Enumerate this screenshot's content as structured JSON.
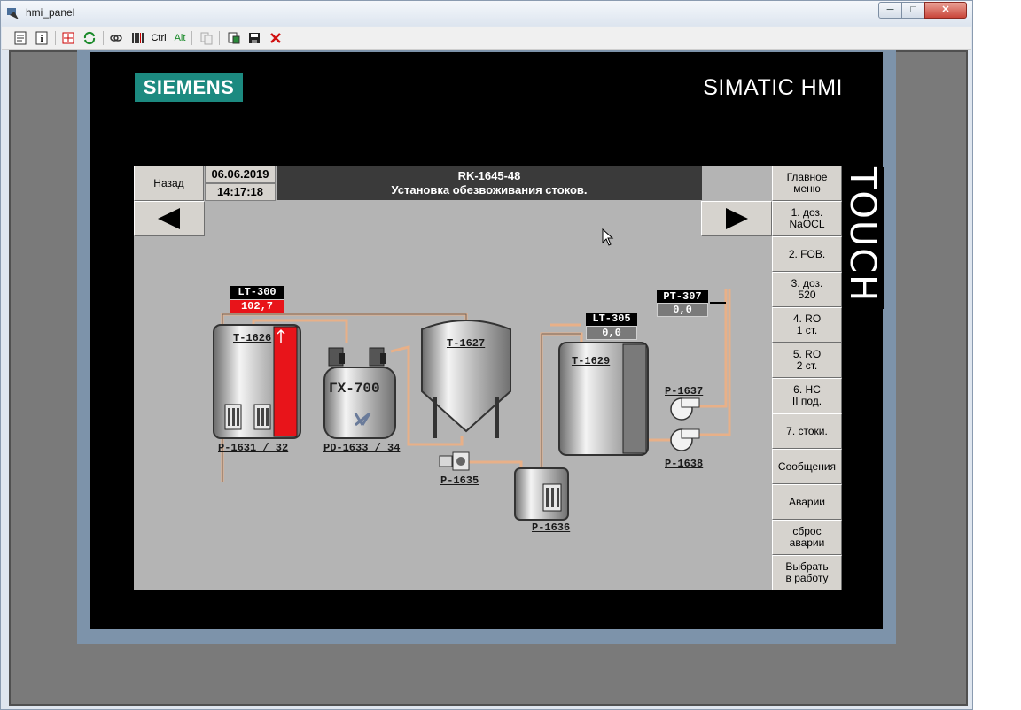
{
  "window": {
    "title": "hmi_panel",
    "buttons": {
      "minimize": "─",
      "maximize": "□",
      "close": "✕"
    }
  },
  "toolbar": {
    "items": [
      "properties-icon",
      "info-icon",
      "fullscreen-icon",
      "refresh-icon",
      "link-icon",
      "barcode-icon",
      "Ctrl",
      "Alt",
      "copy-icon",
      "paste-icon",
      "save-icon",
      "cancel-icon"
    ],
    "ctrl_label": "Ctrl",
    "alt_label": "Alt"
  },
  "panel": {
    "brand": "SIEMENS",
    "model": "SIMATIC HMI",
    "touch_label": "TOUCH",
    "brand_color": "#1c8a80"
  },
  "screen": {
    "back_label": "Назад",
    "date": "06.06.2019",
    "time": "14:17:18",
    "header_line1": "RK-1645-48",
    "header_line2": "Установка обезвоживания стоков.",
    "prev_arrow": "◀",
    "next_arrow": "▶"
  },
  "side_menu": [
    "Главное\nменю",
    "1. доз.\nNaOCL",
    "2. FOB.",
    "3. доз.\n520",
    "4. RO\n1 ст.",
    "5. RO\n2 ст.",
    "6. НС\nII под.",
    "7. стоки.",
    "Сообщения",
    "Аварии",
    "сброс\nаварии",
    "Выбрать\nв работу"
  ],
  "process": {
    "lt300": {
      "tag": "LT-300",
      "value": "102,7",
      "alarm_color": "#e8141a"
    },
    "lt305": {
      "tag": "LT-305",
      "value": "0,0"
    },
    "pt307": {
      "tag": "PT-307",
      "value": "0,0"
    },
    "t1626": "T-1626",
    "t1627": "T-1627",
    "t1629": "T-1629",
    "gx700": "ГХ-700",
    "p1631": "P-1631 / 32",
    "pd1633": "PD-1633 / 34",
    "p1635": "P-1635",
    "p1636": "P-1636",
    "p1637": "P-1637",
    "p1638": "P-1638",
    "pipe_color": "#e8b088"
  }
}
